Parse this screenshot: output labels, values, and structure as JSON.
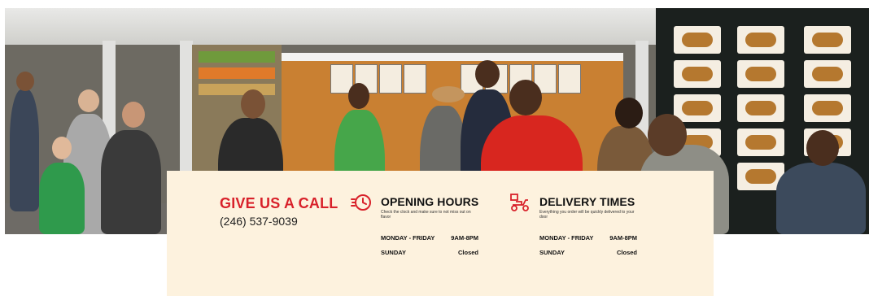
{
  "call": {
    "title": "GIVE US A CALL",
    "phone": "(246) 537-9039"
  },
  "opening": {
    "icon": "clock-icon",
    "title": "OPENING HOURS",
    "subtitle": "Check the clock and make sure to not miss out on flavor",
    "rows": [
      {
        "day": "MONDAY - FRIDAY",
        "time": "9AM-8PM"
      },
      {
        "day": "SUNDAY",
        "time": "Closed"
      }
    ]
  },
  "delivery": {
    "icon": "delivery-scooter-icon",
    "title": "DELIVERY TIMES",
    "subtitle": "Everything you order will be quickly delivered to your door",
    "rows": [
      {
        "day": "MONDAY - FRIDAY",
        "time": "9AM-8PM"
      },
      {
        "day": "SUNDAY",
        "time": "Closed"
      }
    ]
  },
  "colors": {
    "accent": "#d8212a",
    "card_background": "#fdf2de",
    "text_dark": "#111111"
  }
}
